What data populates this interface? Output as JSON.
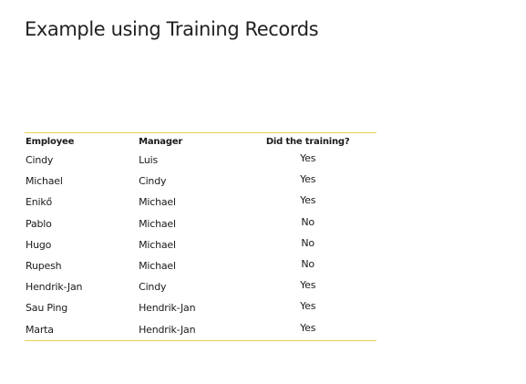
{
  "slide": {
    "title": "Example using Training Records"
  },
  "table": {
    "headers": {
      "employee": "Employee",
      "manager": "Manager",
      "training": "Did the training?"
    },
    "rows": [
      {
        "employee": "Cindy",
        "manager": "Luis",
        "training": "Yes"
      },
      {
        "employee": "Michael",
        "manager": "Cindy",
        "training": "Yes"
      },
      {
        "employee": "Enikő",
        "manager": "Michael",
        "training": "Yes"
      },
      {
        "employee": "Pablo",
        "manager": "Michael",
        "training": "No"
      },
      {
        "employee": "Hugo",
        "manager": "Michael",
        "training": "No"
      },
      {
        "employee": "Rupesh",
        "manager": "Michael",
        "training": "No"
      },
      {
        "employee": "Hendrik-Jan",
        "manager": "Cindy",
        "training": "Yes"
      },
      {
        "employee": "Sau Ping",
        "manager": "Hendrik-Jan",
        "training": "Yes"
      },
      {
        "employee": "Marta",
        "manager": "Hendrik-Jan",
        "training": "Yes"
      }
    ]
  },
  "colors": {
    "rule": "#e8d44d",
    "text": "#1a1a1a"
  }
}
